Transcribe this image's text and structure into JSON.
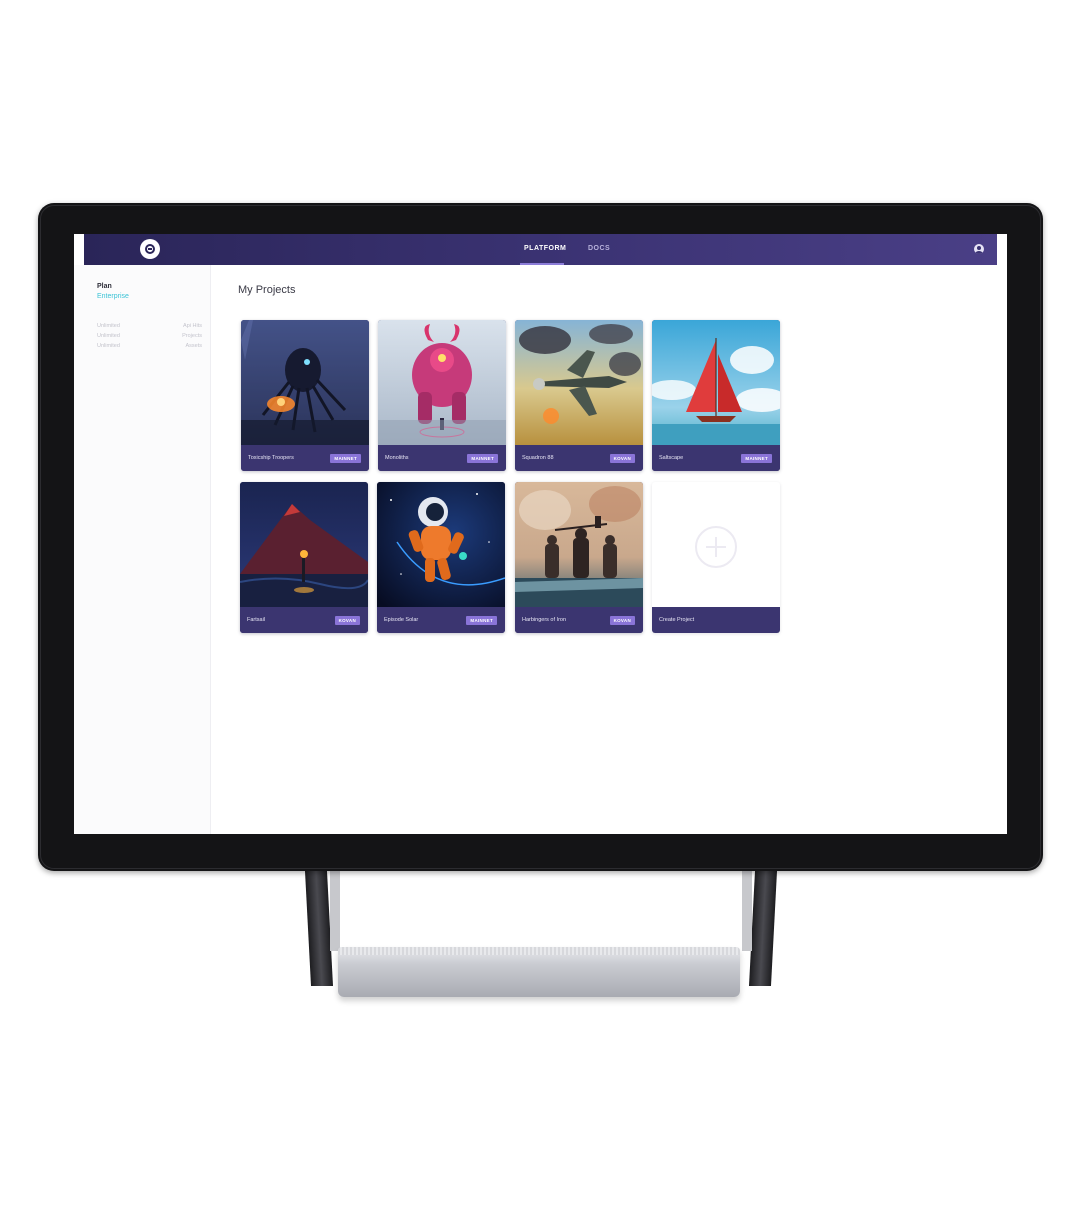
{
  "nav": {
    "tabs": [
      {
        "label": "PLATFORM",
        "active": true
      },
      {
        "label": "DOCS",
        "active": false
      }
    ],
    "logo_icon": "circled-e-logo",
    "user_icon": "user-avatar-icon",
    "colors": {
      "nav_start": "#2a2558",
      "nav_end": "#4a3f86",
      "indicator": "#8c7dd8"
    }
  },
  "sidebar": {
    "plan_label": "Plan",
    "plan_value": "Enterprise",
    "stats": [
      {
        "left": "Unlimited",
        "right": "Api Hits"
      },
      {
        "left": "Unlimited",
        "right": "Projects"
      },
      {
        "left": "Unlimited",
        "right": "Assets"
      }
    ],
    "colors": {
      "accent": "#3bc3d6"
    }
  },
  "main": {
    "title": "My Projects",
    "projects": [
      {
        "name": "Toxicship Troopers",
        "badge": "MAINNET",
        "art": "spider-mech"
      },
      {
        "name": "Monoliths",
        "badge": "MAINNET",
        "art": "pink-monster"
      },
      {
        "name": "Squadron 88",
        "badge": "KOVAN",
        "art": "warplane"
      },
      {
        "name": "Saltscape",
        "badge": "MAINNET",
        "art": "red-sailboat"
      },
      {
        "name": "Fartsail",
        "badge": "KOVAN",
        "art": "volcano-torch"
      },
      {
        "name": "Episode Solar",
        "badge": "MAINNET",
        "art": "astronaut"
      },
      {
        "name": "Harbingers of Iron",
        "badge": "KOVAN",
        "art": "warriors"
      }
    ],
    "create_label": "Create Project",
    "create_icon": "plus-circle-icon",
    "colors": {
      "card_footer": "#3b3570",
      "badge": "#8a74d8"
    }
  }
}
